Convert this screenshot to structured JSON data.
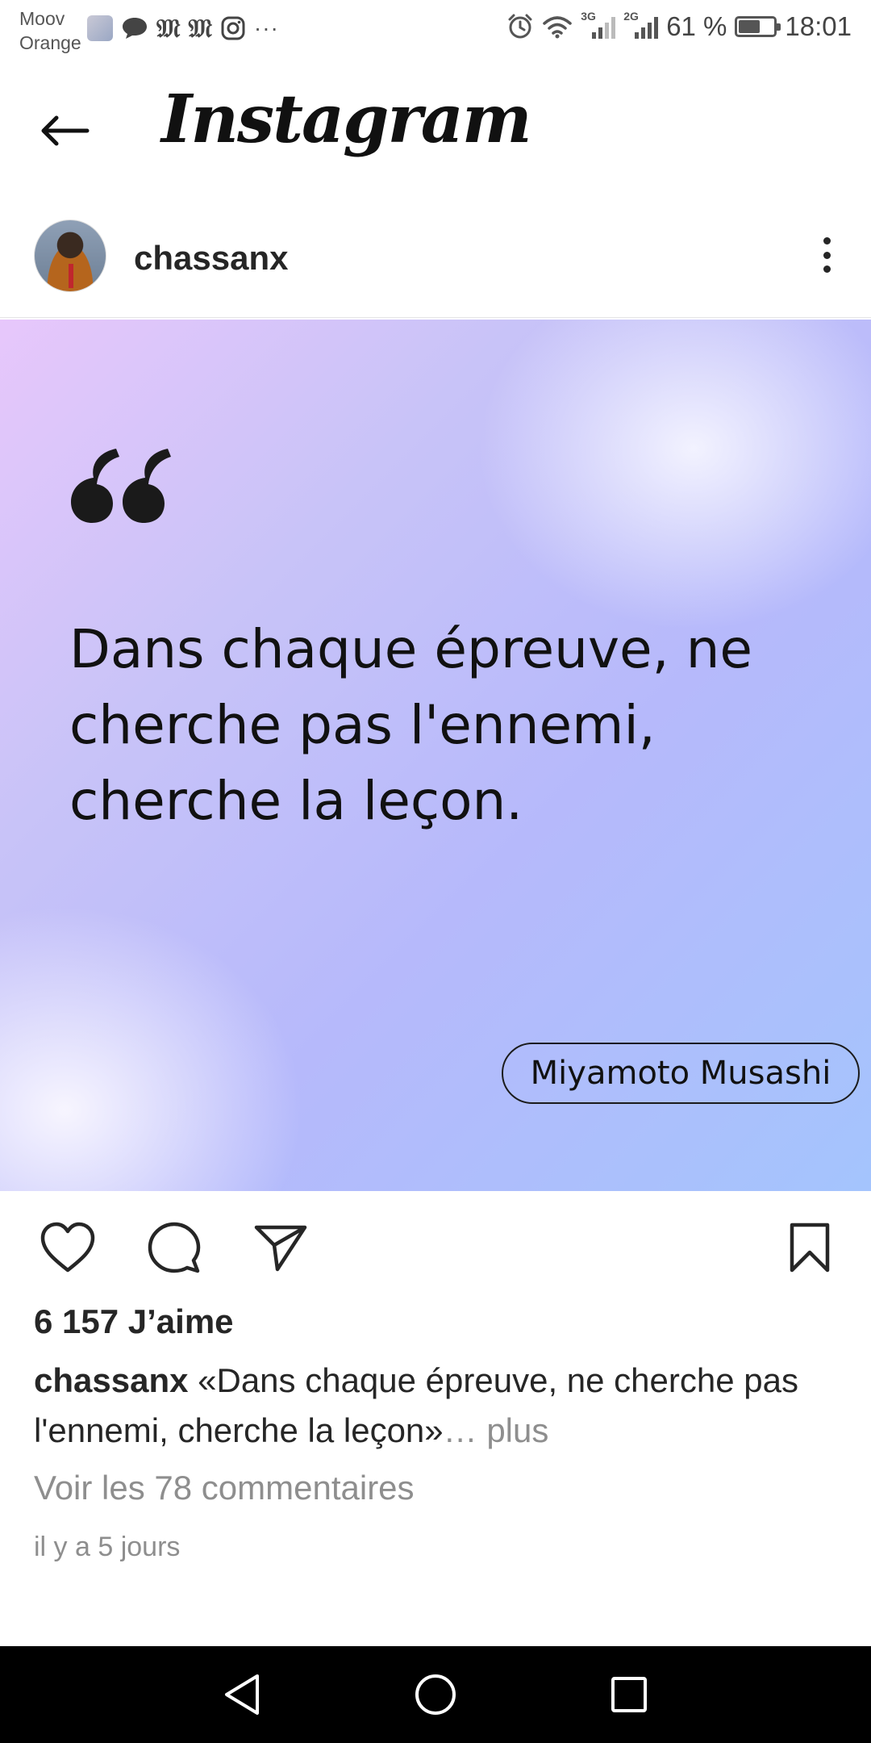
{
  "status_bar": {
    "carrier_line1": "Moov",
    "carrier_line2": "Orange",
    "network_tag_1": "3G",
    "network_tag_2": "2G",
    "battery_text": "61 %",
    "battery_level": 0.61,
    "time": "18:01"
  },
  "header": {
    "app_name": "Instagram"
  },
  "post": {
    "username": "chassanx",
    "quote": "Dans chaque épreuve, ne cherche pas l'ennemi, cherche la leçon.",
    "author": "Miyamoto Musashi",
    "likes": "6 157 J’aime",
    "caption_user": "chassanx",
    "caption_text": " «Dans chaque épreuve, ne cherche pas l'ennemi, cherche la leçon»",
    "caption_more": "… plus",
    "comments_link": "Voir les 78 commentaires",
    "timestamp": "il y a 5 jours"
  },
  "colors": {
    "text": "#262626",
    "secondary": "#8e8e8e",
    "nav_background": "#000000"
  },
  "icons": [
    "back-arrow-icon",
    "more-options-icon",
    "quote-icon",
    "heart-icon",
    "comment-icon",
    "share-icon",
    "bookmark-icon",
    "nav-back-icon",
    "nav-home-icon",
    "nav-recent-icon"
  ]
}
